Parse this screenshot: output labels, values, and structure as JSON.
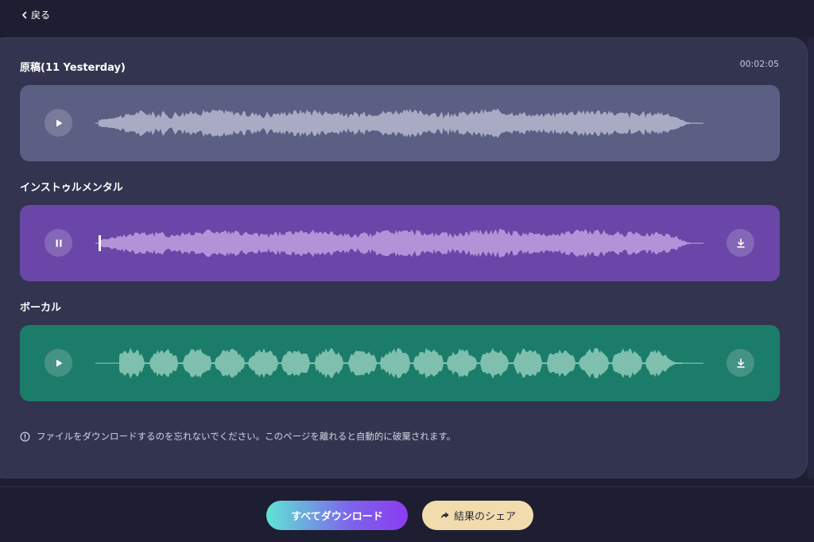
{
  "nav": {
    "back_label": "戻る"
  },
  "original": {
    "title": "原稿(11 Yesterday)",
    "duration": "00:02:05",
    "state": "play",
    "color": "#5b5f83"
  },
  "instrumental": {
    "title": "インストゥルメンタル",
    "state": "pause",
    "color": "#6a46a8"
  },
  "vocal": {
    "title": "ボーカル",
    "state": "play",
    "color": "#1c7c6a"
  },
  "notice": {
    "icon": "info-icon",
    "text": "ファイルをダウンロードするのを忘れないでください。このページを離れると自動的に破棄されます。"
  },
  "footer": {
    "download_all_label": "すべてダウンロード",
    "share_label": "結果のシェア"
  }
}
